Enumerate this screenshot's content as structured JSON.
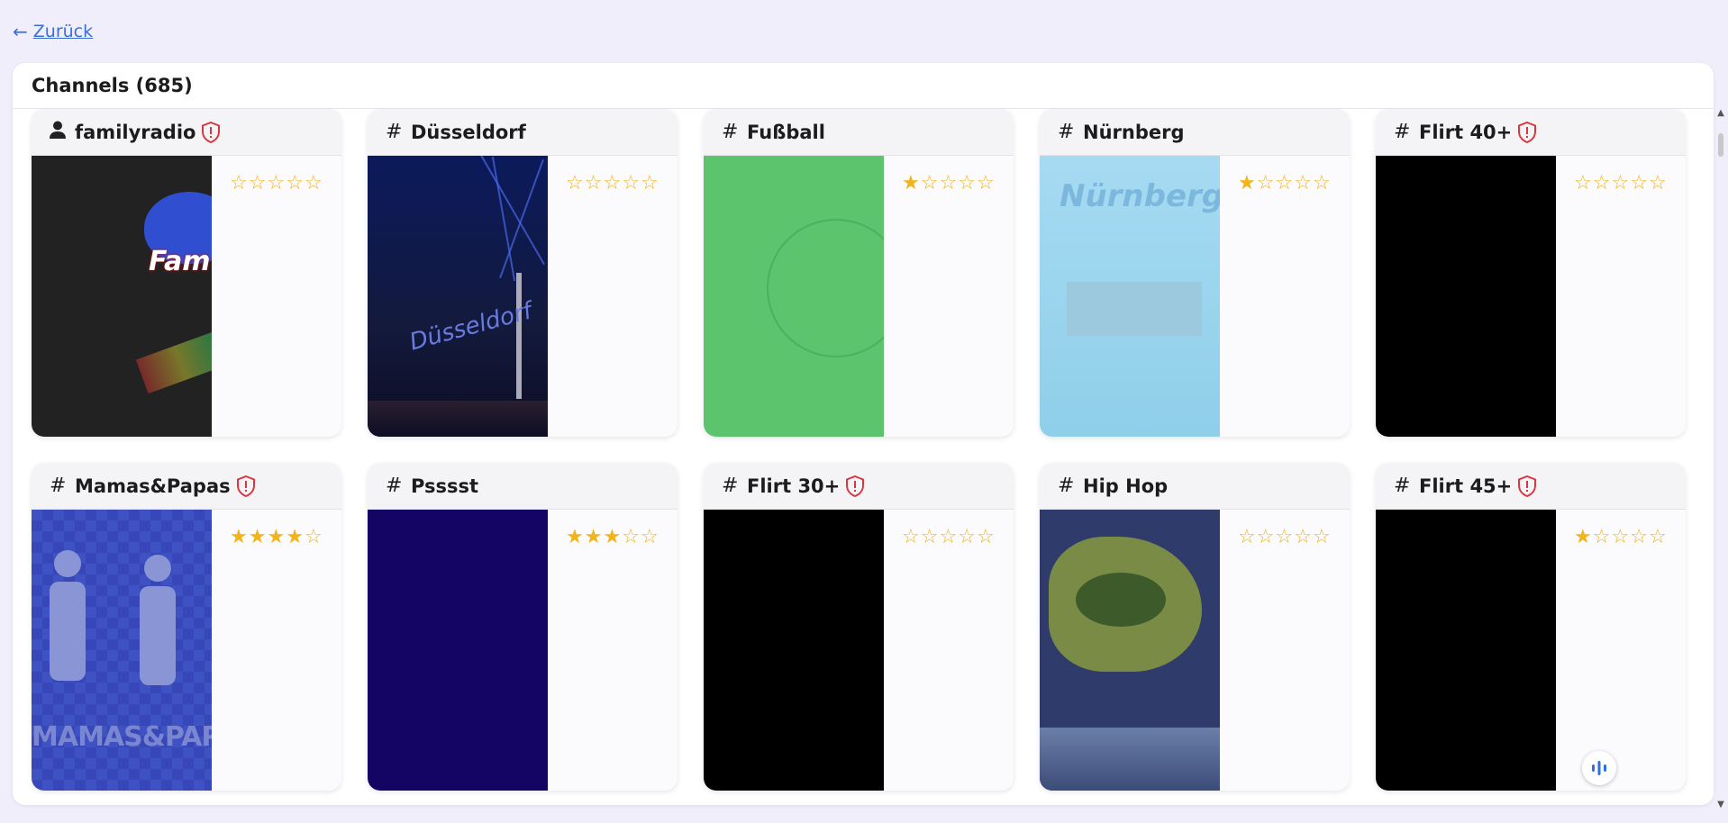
{
  "back": {
    "label": "Zurück",
    "icon": "arrow-left-icon"
  },
  "panel": {
    "title": "Channels (685)"
  },
  "colors": {
    "star": "#f2b31b",
    "warning": "#d9363e",
    "link": "#3a6fd8",
    "fab": "#2f6fe0"
  },
  "channels": [
    {
      "name": "familyradio",
      "kind": "person",
      "warning": true,
      "rating": 0
    },
    {
      "name": "Düsseldorf",
      "kind": "hash",
      "warning": false,
      "rating": 0
    },
    {
      "name": "Fußball",
      "kind": "hash",
      "warning": false,
      "rating": 1
    },
    {
      "name": "Nürnberg",
      "kind": "hash",
      "warning": false,
      "rating": 1
    },
    {
      "name": "Flirt 40+",
      "kind": "hash",
      "warning": true,
      "rating": 0
    },
    {
      "name": "Mamas&Papas",
      "kind": "hash",
      "warning": true,
      "rating": 4
    },
    {
      "name": "Psssst",
      "kind": "hash",
      "warning": false,
      "rating": 3
    },
    {
      "name": "Flirt 30+",
      "kind": "hash",
      "warning": true,
      "rating": 0
    },
    {
      "name": "Hip Hop",
      "kind": "hash",
      "warning": false,
      "rating": 0
    },
    {
      "name": "Flirt 45+",
      "kind": "hash",
      "warning": true,
      "rating": 1
    }
  ],
  "thumb_text": {
    "familyradio": "Fam",
    "Düsseldorf": "Düsseldorf",
    "Nürnberg": "Nürnberg",
    "Mamas&Papas": "MAMAS&PAPAS"
  },
  "fab": {
    "icon": "audio-bars-icon"
  }
}
